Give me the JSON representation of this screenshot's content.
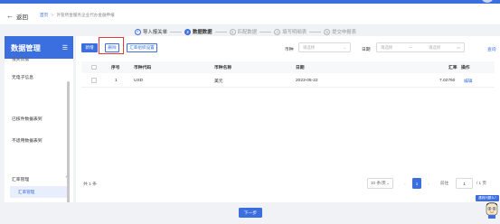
{
  "header": {
    "back_label": "返回",
    "breadcrumb_home": "首页",
    "breadcrumb_current": "外管所金服务企业代办金融申报"
  },
  "steps": [
    {
      "num": "✓",
      "label": "导入报关单"
    },
    {
      "num": "2",
      "label": "数据数据"
    },
    {
      "num": "3",
      "label": "匹配数据"
    },
    {
      "num": "4",
      "label": "填写明细表"
    },
    {
      "num": "5",
      "label": "提交申报表"
    }
  ],
  "sidebar": {
    "title": "数据管理",
    "items": [
      {
        "label": "报关数据"
      },
      {
        "label": "无电子信息"
      },
      {
        "label": "已核件数据表到"
      },
      {
        "label": "不适用数据表到"
      }
    ],
    "group_label": "汇率管理",
    "sub_item": "汇率管理"
  },
  "toolbar": {
    "add_label": "新增",
    "delete_label": "删除",
    "rate_label": "汇率组织设置"
  },
  "filters": {
    "currency_label": "币种",
    "currency_placeholder": "请选择",
    "date_label": "日期",
    "date_start_placeholder": "请选择",
    "date_end_placeholder": "请选择",
    "search_label": "查询"
  },
  "table": {
    "headers": [
      "序号",
      "币种代码",
      "币种名称",
      "日期",
      "汇率",
      "操作"
    ],
    "rows": [
      {
        "index": "1",
        "code": "USD",
        "name": "美元",
        "date": "2023-05-22",
        "rate": "7.02760",
        "op": "编辑"
      }
    ]
  },
  "pagination": {
    "total": "共 1 条",
    "page_size": "10 条/页",
    "current": "1",
    "goto_label": "前往",
    "goto_value": "1",
    "total_pages": "/ 1 页"
  },
  "hint": "遇到问题么?",
  "footer": {
    "next_label": "下一步"
  },
  "colors": {
    "primary": "#3b6fe0",
    "highlight_box": "#e53935"
  }
}
